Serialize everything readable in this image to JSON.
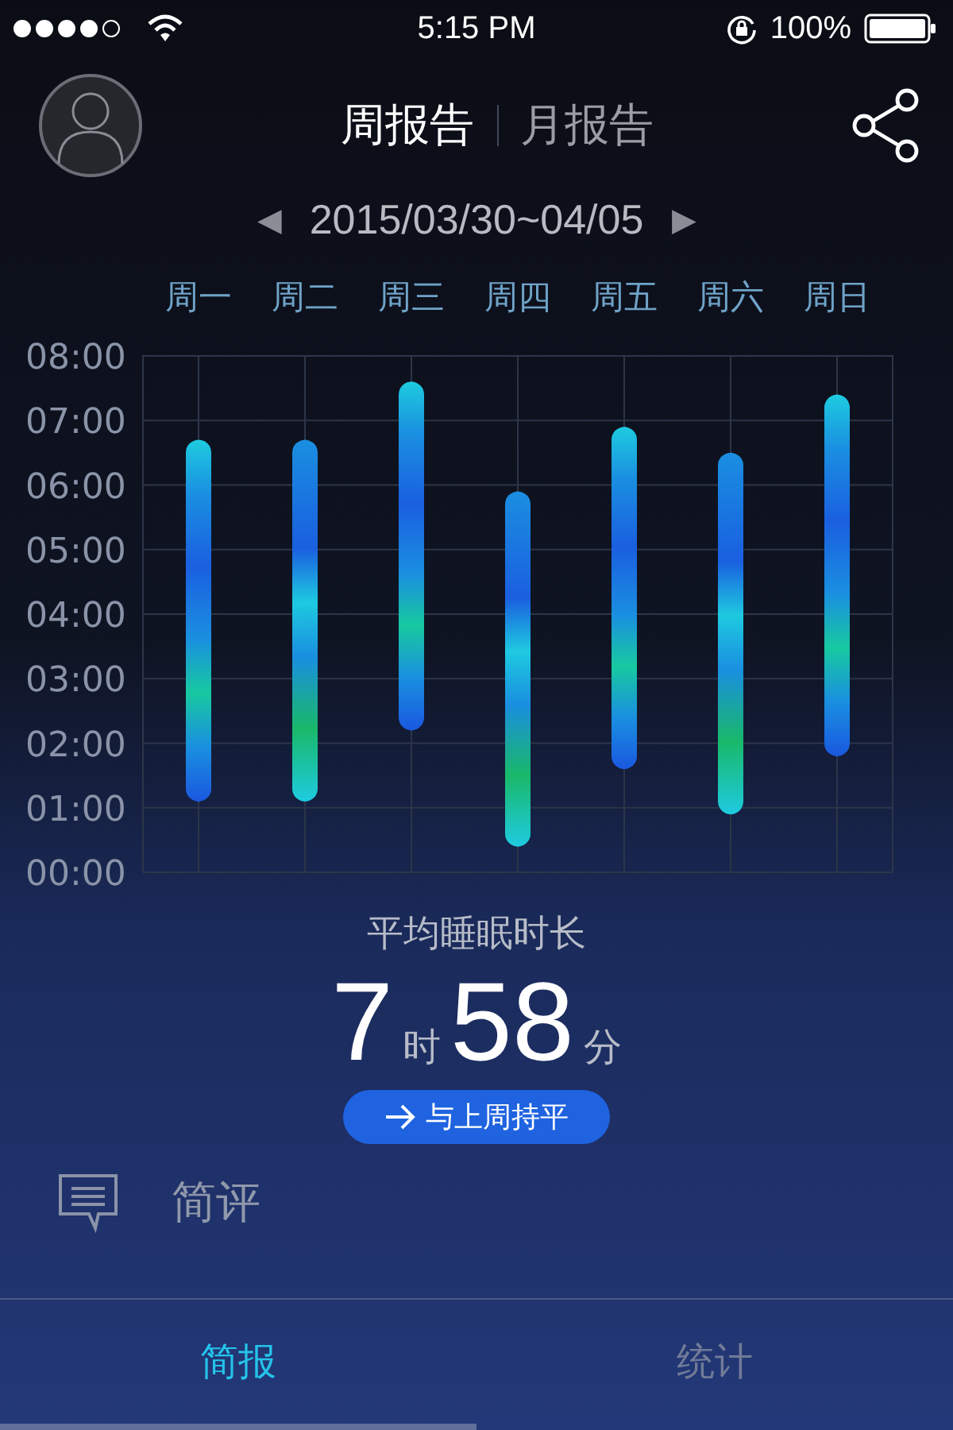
{
  "status_bar": {
    "time": "5:15 PM",
    "battery": "100%"
  },
  "header": {
    "tabs": [
      {
        "label": "周报告",
        "selected": true
      },
      {
        "label": "月报告",
        "selected": false
      }
    ]
  },
  "date_range": {
    "label": "2015/03/30~04/05",
    "prev": "◀",
    "next": "▶"
  },
  "sleep_chart": {
    "chart_data": {
      "type": "candlestick",
      "categories": [
        "周一",
        "周二",
        "周三",
        "周四",
        "周五",
        "周六",
        "周日"
      ],
      "ohlc": [
        [
          1.1,
          6.7,
          1.1,
          6.7
        ],
        [
          1.1,
          6.7,
          1.1,
          6.7
        ],
        [
          2.2,
          7.6,
          2.2,
          7.6
        ],
        [
          0.4,
          5.9,
          0.4,
          5.9
        ],
        [
          1.6,
          6.9,
          1.6,
          6.9
        ],
        [
          0.9,
          6.5,
          0.9,
          6.5
        ],
        [
          1.8,
          7.4,
          1.8,
          7.4
        ]
      ],
      "ylim": [
        0,
        8
      ],
      "grid": true,
      "yticks": [
        {
          "value": 0,
          "label": "00:00"
        },
        {
          "value": 1,
          "label": "01:00"
        },
        {
          "value": 2,
          "label": "02:00"
        },
        {
          "value": 3,
          "label": "03:00"
        },
        {
          "value": 4,
          "label": "04:00"
        },
        {
          "value": 5,
          "label": "05:00"
        },
        {
          "value": 6,
          "label": "06:00"
        },
        {
          "value": 7,
          "label": "07:00"
        },
        {
          "value": 8,
          "label": "08:00"
        }
      ]
    }
  },
  "summary": {
    "title": "平均睡眠时长",
    "hours": "7",
    "hours_unit": "时",
    "minutes": "58",
    "minutes_unit": "分",
    "comparison": "与上周持平"
  },
  "review": {
    "label": "简评"
  },
  "bottom_tabs": [
    {
      "label": "简报",
      "selected": true
    },
    {
      "label": "统计",
      "selected": false
    }
  ]
}
